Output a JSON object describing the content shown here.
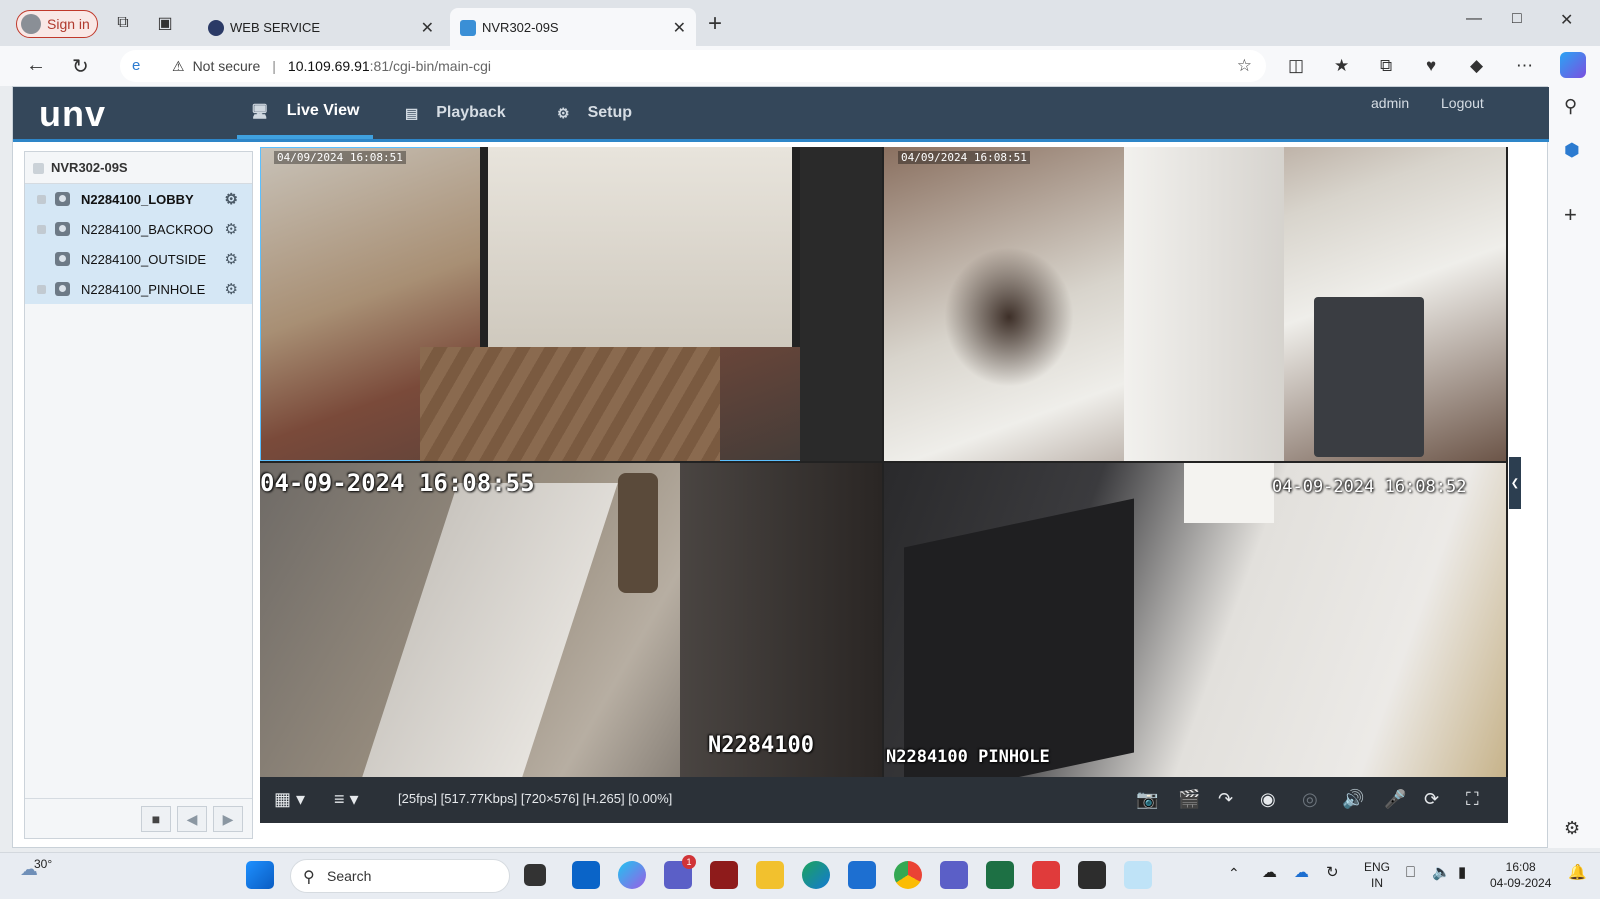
{
  "browser": {
    "signin_label": "Sign in",
    "tabs": [
      {
        "title": "WEB SERVICE",
        "active": false
      },
      {
        "title": "NVR302-09S",
        "active": true
      }
    ],
    "security_label": "Not secure",
    "url_host": "10.109.69.91",
    "url_path": ":81/cgi-bin/main-cgi"
  },
  "app": {
    "logo": "unv",
    "nav": [
      {
        "label": "Live View",
        "icon": "monitor-icon",
        "active": true
      },
      {
        "label": "Playback",
        "icon": "playback-icon",
        "active": false
      },
      {
        "label": "Setup",
        "icon": "gear-icon",
        "active": false
      }
    ],
    "user": "admin",
    "logout": "Logout",
    "device": "NVR302-09S",
    "cameras": [
      {
        "name": "N2284100_LOBBY",
        "selected": true
      },
      {
        "name": "N2284100_BACKROO",
        "selected": false
      },
      {
        "name": "N2284100_OUTSIDE",
        "selected": false
      },
      {
        "name": "N2284100_PINHOLE",
        "selected": false
      }
    ],
    "video": {
      "cells": [
        {
          "osd_time": "04/09/2024 16:08:51",
          "osd_name": ""
        },
        {
          "osd_time": "04/09/2024 16:08:51",
          "osd_name": ""
        },
        {
          "osd_time": "04-09-2024 16:08:55",
          "osd_name": "N2284100"
        },
        {
          "osd_time": "04-09-2024 16:08:52",
          "osd_name": "N2284100 PINHOLE"
        }
      ],
      "stream_info": "[25fps] [517.77Kbps] [720×576] [H.265] [0.00%]"
    }
  },
  "taskbar": {
    "temperature": "30°",
    "search_placeholder": "Search",
    "lang_1": "ENG",
    "lang_2": "IN",
    "time": "16:08",
    "date": "04-09-2024",
    "teams_badge": "1"
  }
}
